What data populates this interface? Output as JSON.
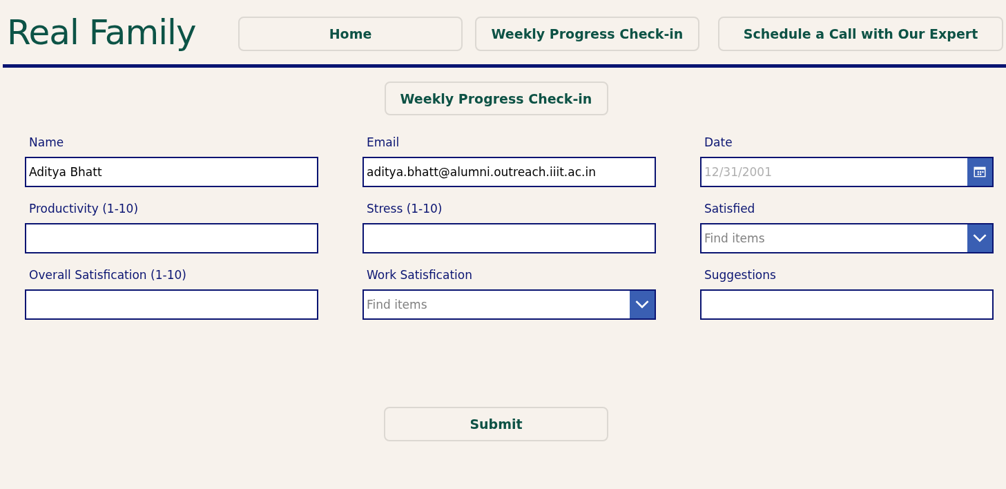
{
  "logo": "Real Family",
  "nav": [
    {
      "label": "Home"
    },
    {
      "label": "Weekly Progress Check-in"
    },
    {
      "label": "Schedule a Call with Our Expert"
    }
  ],
  "form_title": "Weekly Progress Check-in",
  "fields": [
    {
      "kind": "text",
      "label": "Name",
      "value": "Aditya Bhatt"
    },
    {
      "kind": "text",
      "label": "Email",
      "value": "aditya.bhatt@alumni.outreach.iiit.ac.in"
    },
    {
      "kind": "date",
      "label": "Date",
      "placeholder": "12/31/2001"
    },
    {
      "kind": "text",
      "label": "Productivity (1-10)"
    },
    {
      "kind": "text",
      "label": "Stress (1-10)"
    },
    {
      "kind": "combo",
      "label": "Satisfied",
      "placeholder": "Find items"
    },
    {
      "kind": "text",
      "label": "Overall Satisfication (1-10)"
    },
    {
      "kind": "combo",
      "label": "Work Satisfication",
      "placeholder": "Find items"
    },
    {
      "kind": "text",
      "label": "Suggestions"
    }
  ],
  "submit": "Submit"
}
